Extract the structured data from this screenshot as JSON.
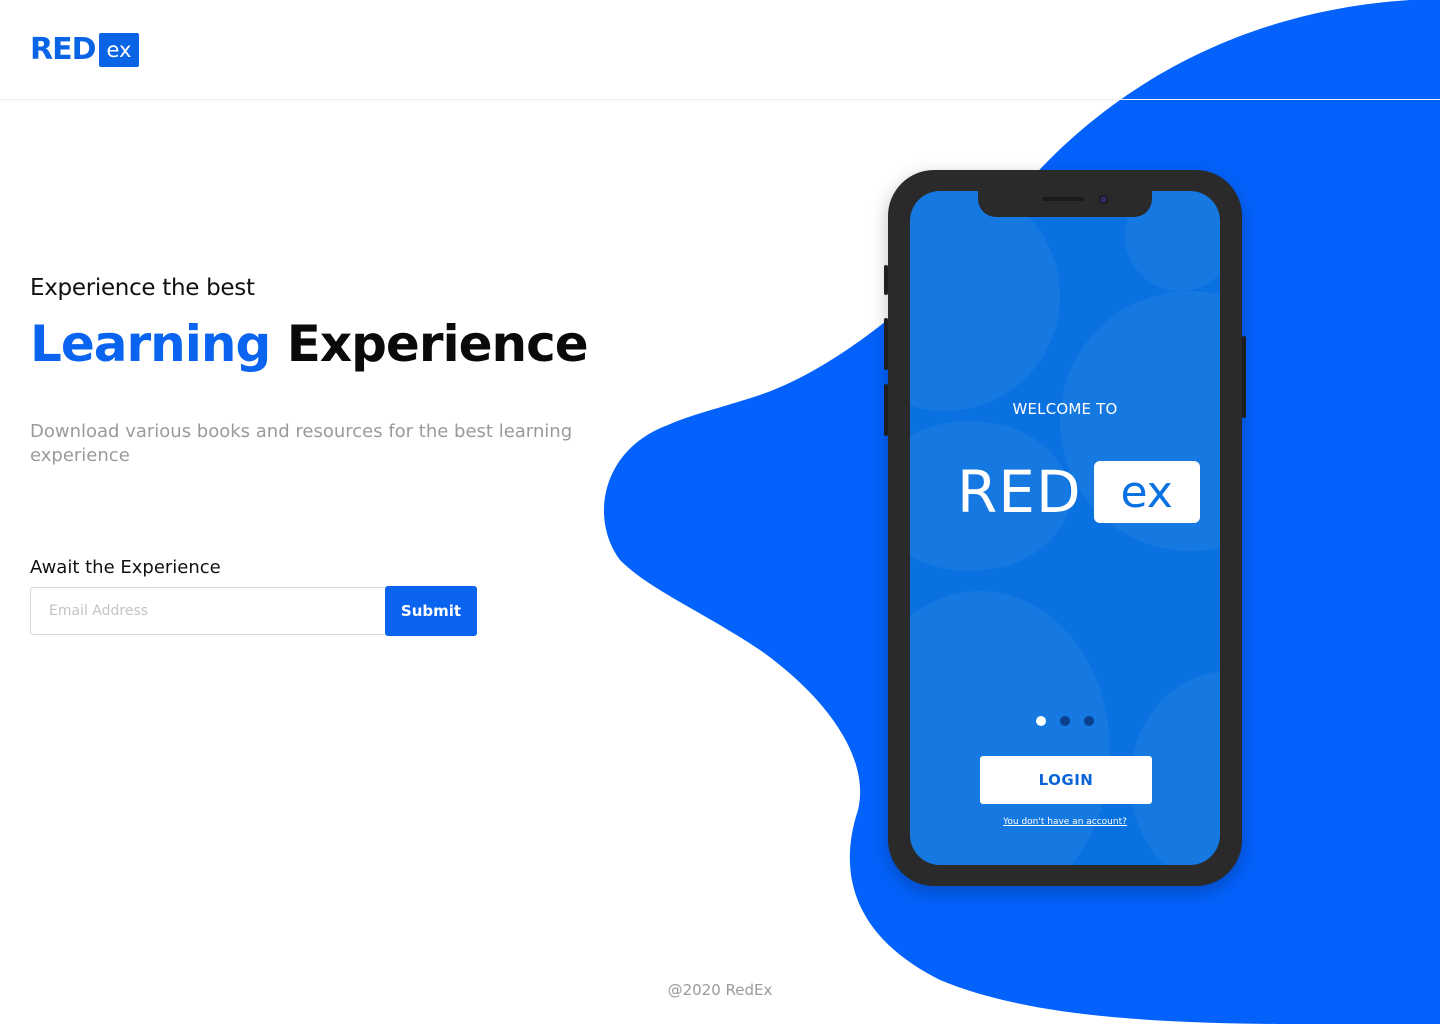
{
  "colors": {
    "brand_blue": "#0a64f0",
    "blob_blue": "#0362fc",
    "screen_blue": "#0a72e0",
    "phone_body": "#2a2a2a",
    "muted_text": "#9a9a9a"
  },
  "header": {
    "logo_main": "RED",
    "logo_badge": "ex"
  },
  "hero": {
    "eyebrow": "Experience the best",
    "title_highlight": "Learning",
    "title_rest": "Experience",
    "description": "Download various books and resources for the best learning experience"
  },
  "signup": {
    "label": "Await the Experience",
    "email_placeholder": "Email Address",
    "email_value": "",
    "submit_label": "Submit"
  },
  "phone": {
    "welcome": "WELCOME TO",
    "logo_main": "RED",
    "logo_badge": "ex",
    "carousel": {
      "total": 3,
      "active_index": 0
    },
    "login_label": "LOGIN",
    "signup_link": "You don't have an account?"
  },
  "footer": {
    "copyright": "@2020 RedEx"
  }
}
